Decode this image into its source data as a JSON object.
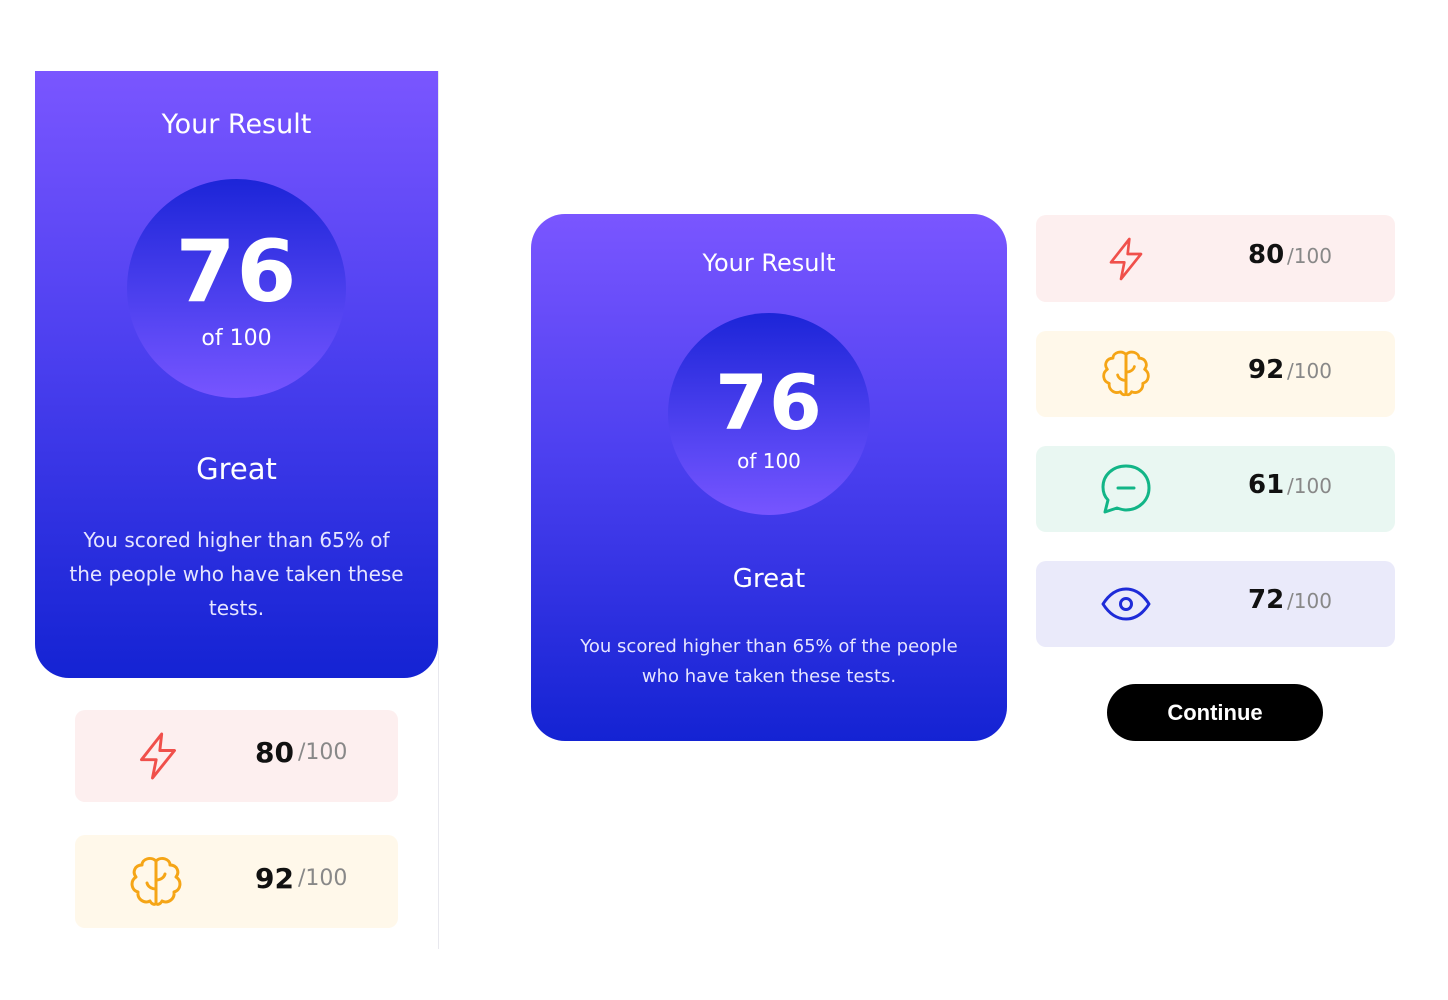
{
  "result": {
    "title": "Your Result",
    "score": "76",
    "of_label": "of 100",
    "grade": "Great",
    "description": "You scored higher than 65% of the people who have taken these tests."
  },
  "stats": [
    {
      "icon": "lightning-icon",
      "value": "80",
      "max": "/100",
      "color": "#f0504b",
      "bg": "#fdefef"
    },
    {
      "icon": "brain-icon",
      "value": "92",
      "max": "/100",
      "color": "#f5a516",
      "bg": "#fff8ea"
    },
    {
      "icon": "chat-bubble-icon",
      "value": "61",
      "max": "/100",
      "color": "#12b587",
      "bg": "#e9f7f2"
    },
    {
      "icon": "eye-icon",
      "value": "72",
      "max": "/100",
      "color": "#1e2bd8",
      "bg": "#eaeafa"
    }
  ],
  "continue_label": "Continue"
}
